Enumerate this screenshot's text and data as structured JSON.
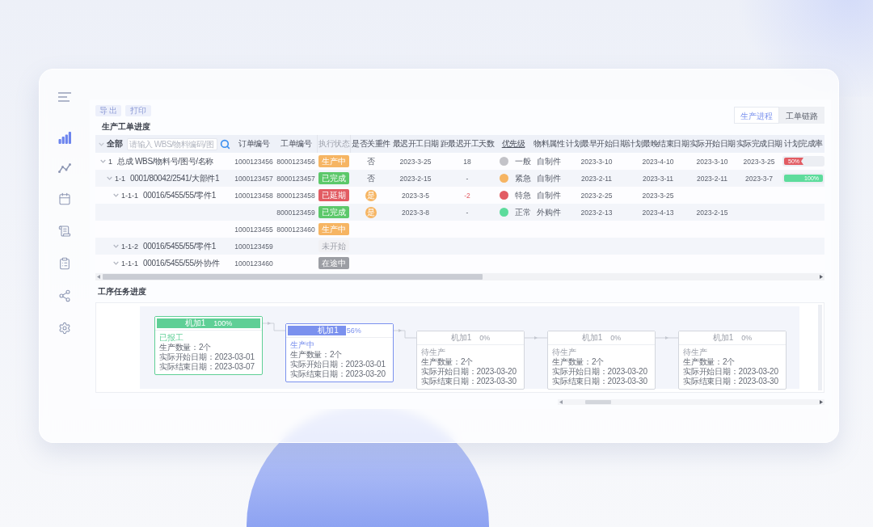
{
  "sidebar": {
    "items": [
      {
        "selected": true
      },
      {
        "selected": false
      },
      {
        "selected": false
      },
      {
        "selected": false
      },
      {
        "selected": false
      },
      {
        "selected": false
      },
      {
        "selected": false
      }
    ]
  },
  "toolbar": {
    "buttons": [
      "导 出",
      "打印"
    ]
  },
  "tabs": [
    {
      "label": "生产进程",
      "selected": true
    },
    {
      "label": "工单链路",
      "selected": false
    }
  ],
  "table": {
    "title": "生产工单进度",
    "all_label": "全部",
    "search": {
      "placeholder": "请输入 WBS/物料编码/图"
    },
    "columns": [
      {
        "label": "订单编号",
        "disabled": false,
        "underlined": false
      },
      {
        "label": "工单编号",
        "disabled": false,
        "underlined": false
      },
      {
        "label": "执行状态",
        "disabled": true,
        "underlined": false
      },
      {
        "label": "是否关重件",
        "disabled": false,
        "underlined": false
      },
      {
        "label": "最迟开工日期",
        "disabled": false,
        "underlined": false
      },
      {
        "label": "距最迟开工天数",
        "disabled": false,
        "underlined": false
      },
      {
        "label": "优先级",
        "disabled": false,
        "underlined": true
      },
      {
        "label": "物料属性",
        "disabled": false,
        "underlined": false
      },
      {
        "label": "计划最早开始日期",
        "disabled": false,
        "underlined": false
      },
      {
        "label": "计划最晚结束日期",
        "disabled": false,
        "underlined": false
      },
      {
        "label": "实际开始日期",
        "disabled": false,
        "underlined": false
      },
      {
        "label": "实际完成日期",
        "disabled": false,
        "underlined": false
      },
      {
        "label": "计划完成率",
        "disabled": false,
        "underlined": false
      }
    ],
    "tree": [
      {
        "code": "1",
        "label": "总成 WBS/物料号/图号/名称",
        "expanded": true,
        "orders": [
          {
            "order_no": "1000123456",
            "work_order_no": "8000123456",
            "status": {
              "text": "生产中",
              "kind": "producing"
            },
            "key_part": {
              "text": "否",
              "badge": false
            },
            "latest_start": "2023-3-25",
            "days": {
              "text": "18",
              "overdue": false
            },
            "priority": {
              "text": "一般",
              "color": "#c3c3c8"
            },
            "material": "自制件",
            "plan_start": "2023-3-10",
            "plan_end": "2023-4-10",
            "actual_start": "2023-3-10",
            "actual_end": "2023-3-25",
            "completion": {
              "text": "50%",
              "level": 0.5,
              "color": "#e25c63"
            }
          }
        ],
        "children": [
          {
            "code": "1-1",
            "label": "0001/80042/2541/大部件1",
            "expanded": true,
            "orders": [
              {
                "order_no": "1000123457",
                "work_order_no": "8000123457",
                "status": {
                  "text": "已完成",
                  "kind": "done"
                },
                "key_part": {
                  "text": "否",
                  "badge": false
                },
                "latest_start": "2023-2-15",
                "days": {
                  "text": "-",
                  "overdue": false
                },
                "priority": {
                  "text": "紧急",
                  "color": "#f6b563"
                },
                "material": "自制件",
                "plan_start": "2023-2-11",
                "plan_end": "2023-3-11",
                "actual_start": "2023-2-11",
                "actual_end": "2023-3-7",
                "completion": {
                  "text": "100%",
                  "level": 1,
                  "color": "#5ddc9c"
                }
              }
            ],
            "children": [
              {
                "code": "1-1-1",
                "label": "00016/5455/55/零件1",
                "expanded": true,
                "orders": [
                  {
                    "order_no": "1000123458",
                    "work_order_no": "8000123458",
                    "status": {
                      "text": "已延期",
                      "kind": "delayed"
                    },
                    "key_part": {
                      "text": "是",
                      "badge": true
                    },
                    "latest_start": "2023-3-5",
                    "days": {
                      "text": "-2",
                      "overdue": true
                    },
                    "priority": {
                      "text": "特急",
                      "color": "#e25c63"
                    },
                    "material": "自制件",
                    "plan_start": "2023-2-25",
                    "plan_end": "2023-3-25"
                  },
                  {
                    "work_order_no": "8000123459",
                    "status": {
                      "text": "已完成",
                      "kind": "done"
                    },
                    "key_part": {
                      "text": "是",
                      "badge": true
                    },
                    "latest_start": "2023-3-8",
                    "days": {
                      "text": "-",
                      "overdue": false
                    },
                    "priority": {
                      "text": "正常",
                      "color": "#5ddc9c"
                    },
                    "material": "外购件",
                    "plan_start": "2023-2-13",
                    "plan_end": "2023-4-13",
                    "actual_start": "2023-2-15"
                  },
                  {
                    "order_no": "1000123455",
                    "work_order_no": "8000123460",
                    "status": {
                      "text": "生产中",
                      "kind": "producing"
                    }
                  }
                ]
              },
              {
                "code": "1-1-2",
                "label": "00016/5455/55/零件1",
                "expanded": true,
                "orders": [
                  {
                    "order_no": "1000123459",
                    "status": {
                      "text": "未开始",
                      "kind": "pending"
                    }
                  }
                ]
              },
              {
                "code": "1-1-1",
                "label": "00016/5455/55/外协件",
                "expanded": true,
                "orders": [
                  {
                    "order_no": "1000123460",
                    "status": {
                      "text": "在途中",
                      "kind": "transit"
                    }
                  }
                ]
              }
            ]
          }
        ]
      }
    ]
  },
  "flow": {
    "title": "工序任务进度",
    "nodes": [
      {
        "title": "机加1",
        "percent": "100%",
        "level": 1,
        "color": "#5fcf96",
        "status": "已报工",
        "lines": [
          "生产数量：2个",
          "实际开始日期：2023-03-01",
          "实际结束日期：2023-03-07"
        ]
      },
      {
        "title": "机加1",
        "percent": "56%",
        "level": 0.56,
        "color": "#7b91ee",
        "status": "生产中",
        "lines": [
          "生产数量：2个",
          "实际开始日期：2023-03-01",
          "实际结束日期：2023-03-20"
        ]
      },
      {
        "title": "机加1",
        "percent": "0%",
        "color": "#d3d6dd",
        "status": "待生产",
        "lines": [
          "生产数量：2个",
          "实际开始日期：2023-03-20",
          "实际结束日期：2023-03-30"
        ]
      },
      {
        "title": "机加1",
        "percent": "0%",
        "color": "#d3d6dd",
        "status": "待生产",
        "lines": [
          "生产数量：2个",
          "实际开始日期：2023-03-20",
          "实际结束日期：2023-03-30"
        ]
      },
      {
        "title": "机加1",
        "percent": "0%",
        "color": "#d3d6dd",
        "status": "待生产",
        "lines": [
          "生产数量：2个",
          "实际开始日期：2023-03-20",
          "实际结束日期：2023-03-30"
        ]
      }
    ]
  }
}
